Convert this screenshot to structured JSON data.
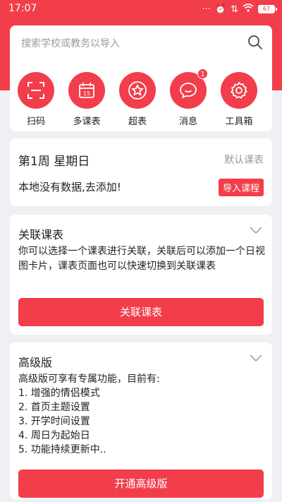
{
  "status": {
    "time": "17:07",
    "battery": "67"
  },
  "search": {
    "placeholder": "搜索学校或教务以导入"
  },
  "quick_actions": [
    {
      "label": "扫码",
      "icon": "scan-icon"
    },
    {
      "label": "多课表",
      "icon": "calendar-icon"
    },
    {
      "label": "超表",
      "icon": "star-icon"
    },
    {
      "label": "消息",
      "icon": "chat-icon",
      "badge": "1"
    },
    {
      "label": "工具箱",
      "icon": "gear-icon"
    }
  ],
  "week": {
    "title": "第1周  星期日",
    "default_label": "默认课表",
    "empty_text": "本地没有数据,去添加!",
    "import_label": "导入课程"
  },
  "link_section": {
    "title": "关联课表",
    "description": "你可以选择一个课表进行关联，关联后可以添加一个日视图卡片，课表页面也可以快速切换到关联课表",
    "button_label": "关联课表"
  },
  "pro_section": {
    "title": "高级版",
    "intro": "高级版可享有专属功能，目前有:",
    "features": [
      "1. 增强的情侣模式",
      "2. 首页主题设置",
      "3. 开学时间设置",
      "4. 周日为起始日",
      "5. 功能持续更新中.."
    ],
    "button_label": "开通高级版"
  },
  "colors": {
    "accent": "#f23d4b",
    "background": "#eef0f3"
  }
}
